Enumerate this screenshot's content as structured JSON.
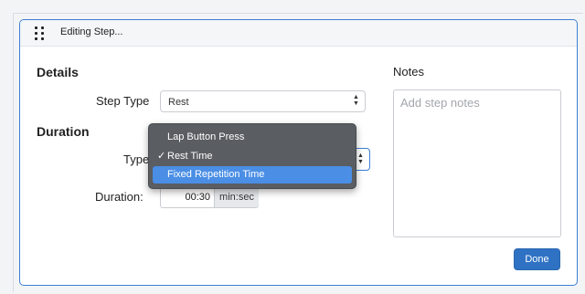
{
  "header": {
    "title": "Editing Step..."
  },
  "details": {
    "title": "Details",
    "step_type_label": "Step Type",
    "step_type_value": "Rest"
  },
  "duration": {
    "title": "Duration",
    "type_label": "Type",
    "duration_label": "Duration:",
    "duration_value": "00:30",
    "duration_unit": "min:sec"
  },
  "notes": {
    "label": "Notes",
    "placeholder": "Add step notes"
  },
  "done_button": "Done",
  "type_menu": {
    "items": [
      {
        "label": "Lap Button Press",
        "checked": false,
        "highlighted": false
      },
      {
        "label": "Rest Time",
        "checked": true,
        "highlighted": false
      },
      {
        "label": "Fixed Repetition Time",
        "checked": false,
        "highlighted": true
      }
    ],
    "check_glyph": "✓"
  },
  "colors": {
    "accent": "#2f72c4",
    "highlight": "#4a8ee5",
    "menu_bg": "#5a5d62"
  }
}
